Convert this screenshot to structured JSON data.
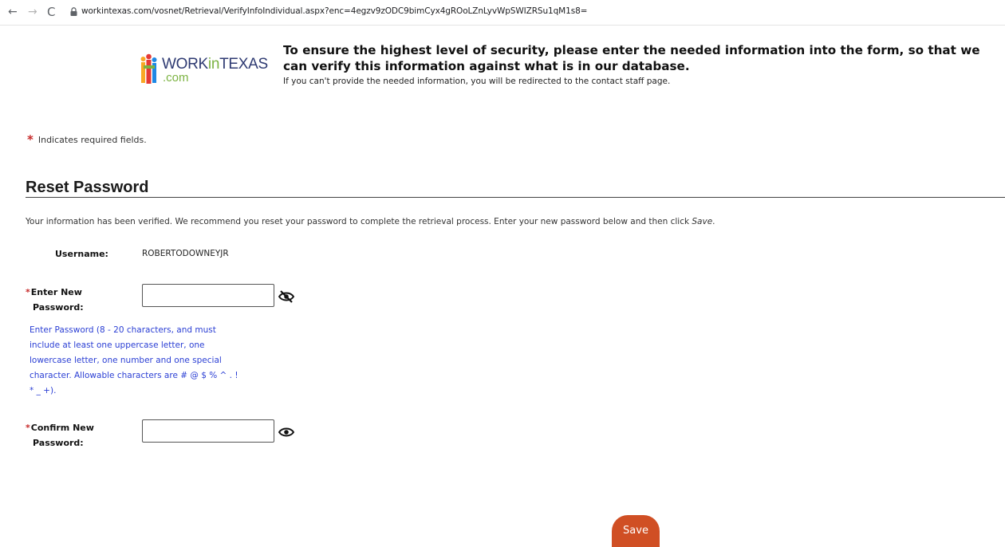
{
  "browser": {
    "url": "workintexas.com/vosnet/Retrieval/VerifyInfoIndividual.aspx?enc=4egzv9zODC9bimCyx4gROoLZnLyvWpSWIZRSu1qM1s8=",
    "back": "←",
    "forward": "→",
    "reload": "C"
  },
  "logo": {
    "word_a": "WORK",
    "word_in": "in",
    "word_b": "TEXAS",
    "com": ".com"
  },
  "header": {
    "heading": "To ensure the highest level of security, please enter the needed information into the form, so that we can verify this information against what is in our database.",
    "sub": "If you can't provide the needed information, you will be redirected to the contact staff page."
  },
  "required_note": {
    "star": "*",
    "text": "Indicates required fields."
  },
  "section": {
    "title": "Reset Password",
    "intro_prefix": "Your information has been verified. We recommend you reset your password to complete the retrieval process. Enter your new password below and then click ",
    "intro_emph": "Save",
    "intro_suffix": "."
  },
  "form": {
    "username_label": "Username:",
    "username_value": "ROBERTODOWNEYJR",
    "new_pw_line1": "Enter New",
    "new_pw_line2": "Password:",
    "confirm_pw_line1": "Confirm New",
    "confirm_pw_line2": "Password:",
    "required_star": "*",
    "new_pw_value": "",
    "confirm_pw_value": "",
    "help_text": "Enter Password (8 - 20 characters, and must include at least one uppercase letter, one lowercase letter, one number and one special character. Allowable characters are # @ $ % ^ . ! * _ +).",
    "new_pw_toggle_icon": "eye-slash-icon",
    "confirm_pw_toggle_icon": "eye-icon"
  },
  "save_label": "Save",
  "colors": {
    "accent": "#d04f24",
    "help_text": "#2b3fd4",
    "required": "#c62828",
    "logo_blue": "#2e3a72",
    "logo_green": "#7cb342"
  }
}
